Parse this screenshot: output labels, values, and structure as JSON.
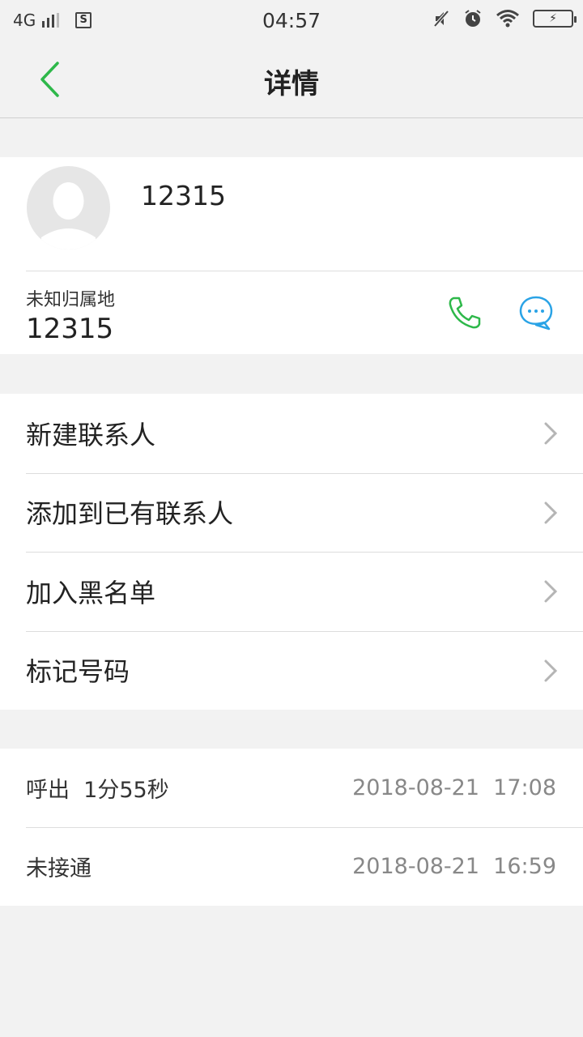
{
  "status_bar": {
    "network": "4G",
    "time": "04:57",
    "sim_label": "S"
  },
  "nav": {
    "title": "详情"
  },
  "contact": {
    "name": "12315",
    "location": "未知归属地",
    "number": "12315"
  },
  "menu": {
    "items": [
      {
        "label": "新建联系人"
      },
      {
        "label": "添加到已有联系人"
      },
      {
        "label": "加入黑名单"
      },
      {
        "label": "标记号码"
      }
    ]
  },
  "call_log": {
    "entries": [
      {
        "desc": "呼出  1分55秒",
        "datetime": "2018-08-21  17:08"
      },
      {
        "desc": "未接通",
        "datetime": "2018-08-21  16:59"
      }
    ]
  },
  "colors": {
    "accent_green": "#2eb84a",
    "accent_blue": "#2aa3e6"
  }
}
